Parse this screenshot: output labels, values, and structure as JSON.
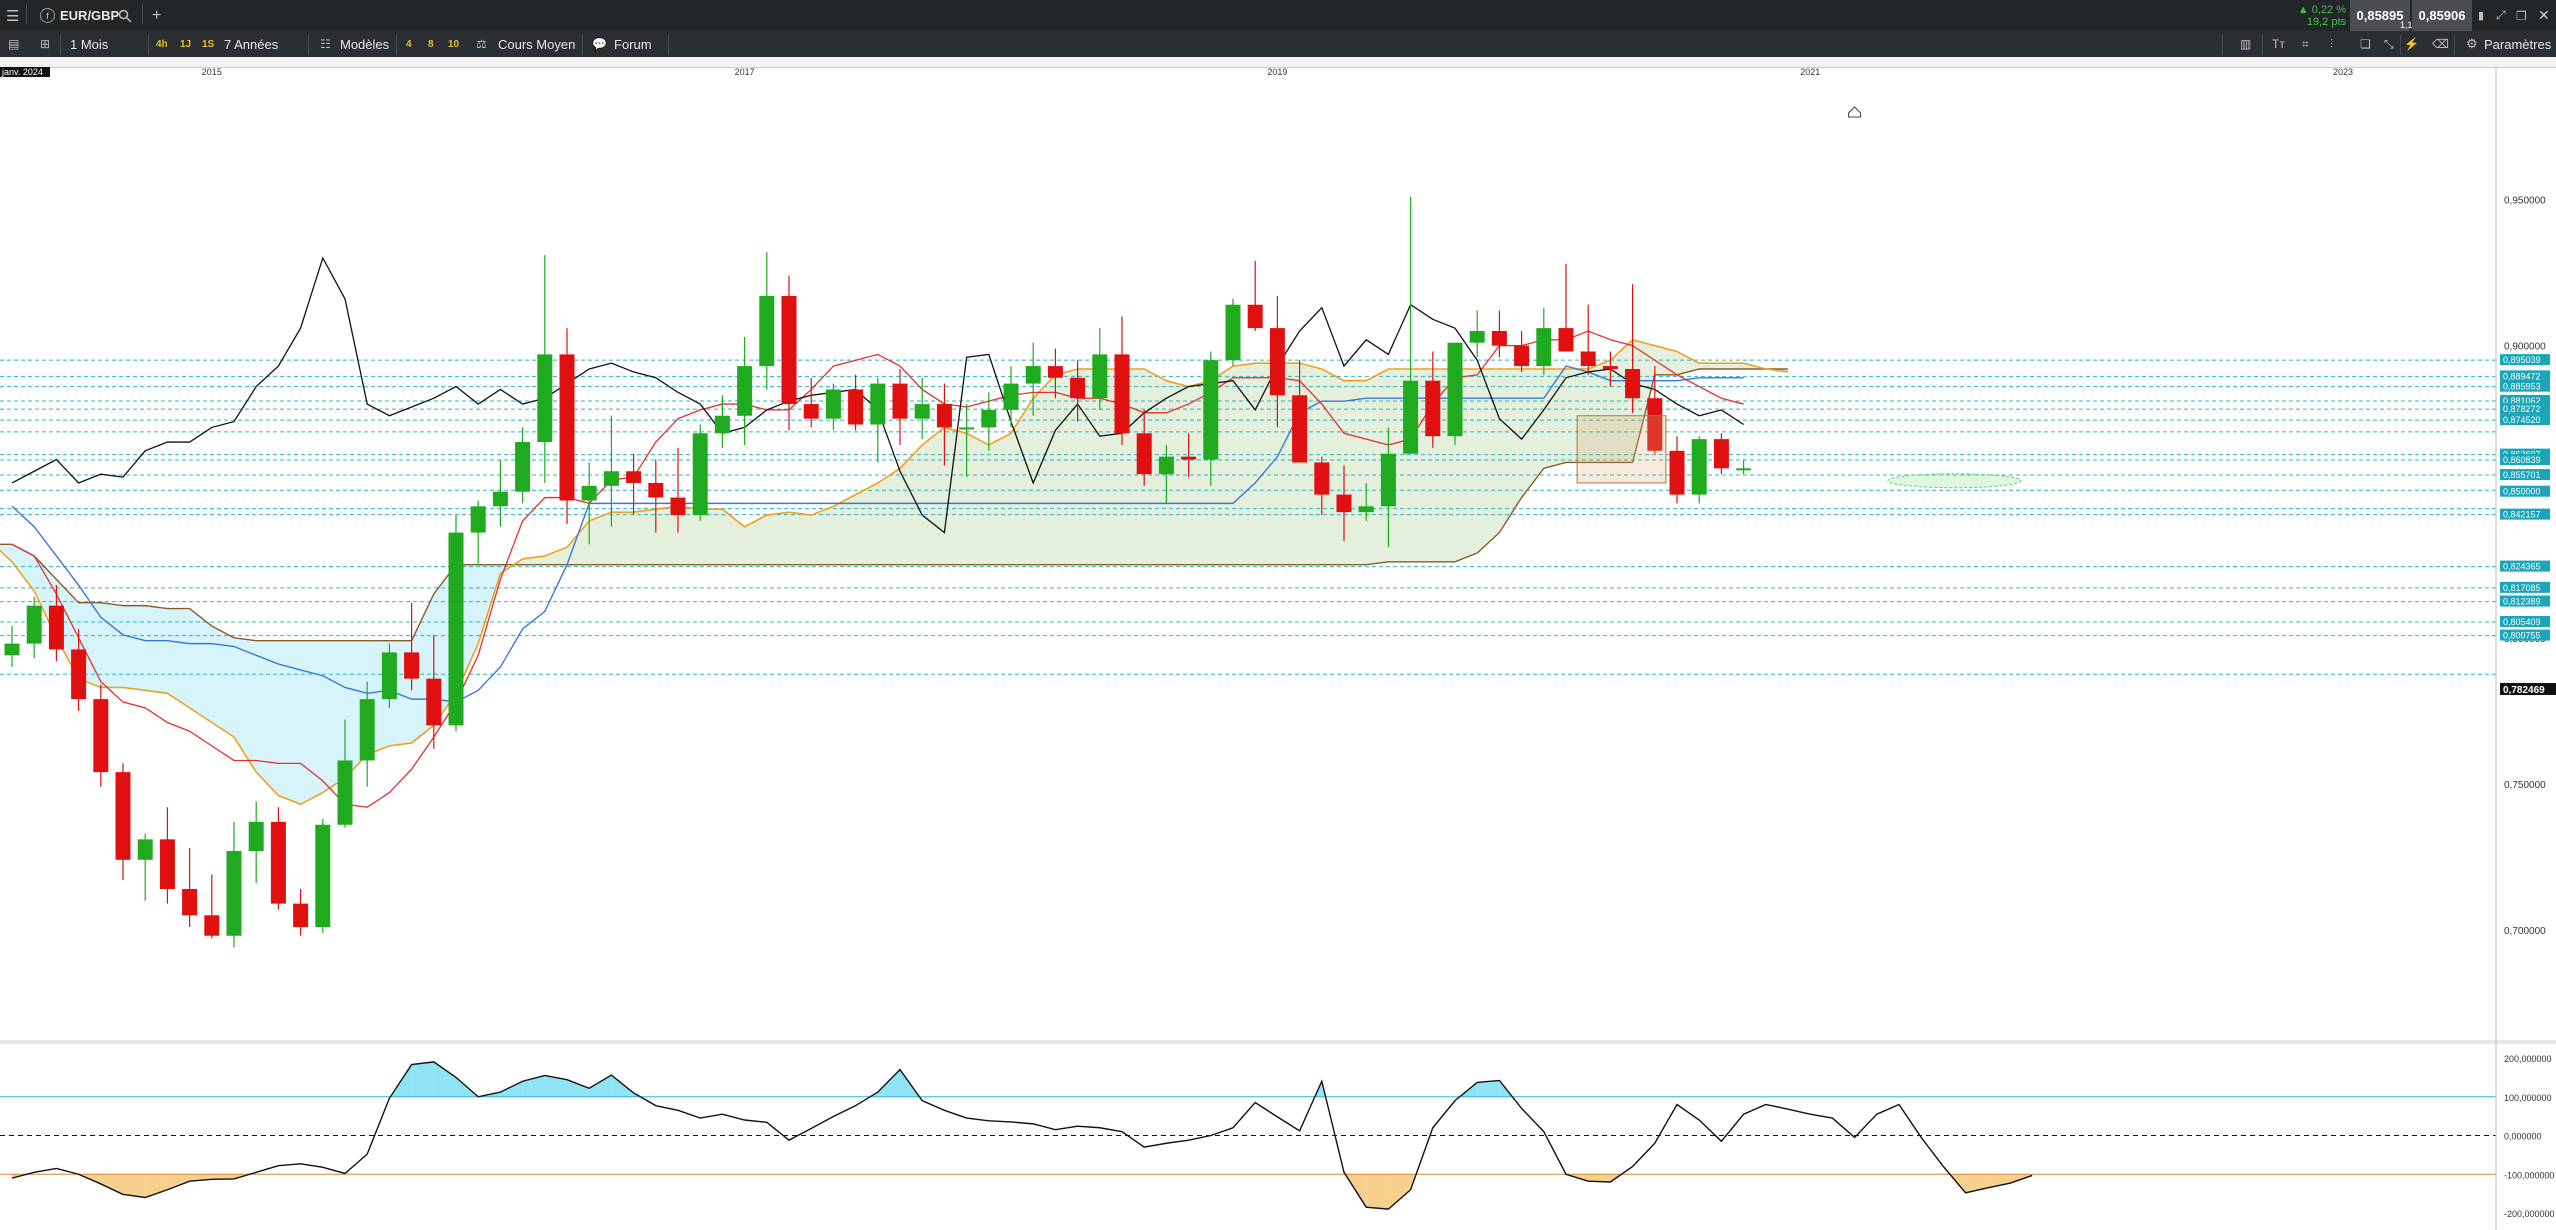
{
  "instrument": {
    "symbol": "EUR/GBP",
    "change_pct": "▲ 0,22 %",
    "change_pts": "19,2 pts",
    "bid": "0,85895",
    "ask": "0,85906",
    "spread": "1,1",
    "settings_label": "Paramètres"
  },
  "toolbar": {
    "period": "1 Mois",
    "tf_4h": "4h",
    "tf_1j": "1J",
    "tf_1s": "1S",
    "range": "7 Années",
    "models_label": "Modèles",
    "m_4": "4",
    "m_8": "8",
    "m_10": "10",
    "average_label": "Cours Moyen",
    "forum_label": "Forum"
  },
  "datebar": {
    "current_label": "janv. 2024",
    "years": [
      "2015",
      "2017",
      "2019",
      "2021",
      "2023"
    ]
  },
  "colors": {
    "bull": "#1faa1f",
    "bear": "#e01010",
    "tenkan": "#e23030",
    "kijun": "#3a78d8",
    "chikou": "#111111",
    "span_a": "#f0a020",
    "span_b": "#8a5a2a",
    "cloud_bull": "#d6f4f9",
    "cloud_bear": "#e4efdc",
    "level_line": "#27b5c8",
    "cci_pos_fill": "#8fe3f4",
    "cci_neg_fill": "#f7cf8e"
  },
  "chart_data": [
    {
      "type": "candlestick",
      "title": "",
      "x_start": "2014-04",
      "interval": "1M",
      "x_axis_ticks": [
        "2015",
        "2017",
        "2019",
        "2021",
        "2023"
      ],
      "y_axis_ticks": [
        "0,950000",
        "0,900000",
        "0,850000",
        "0,800000",
        "0,750000",
        "0,700000"
      ],
      "ylim": [
        0.663,
        0.981
      ],
      "last_price_label": "0,782469",
      "ohlc": [
        [
          0.794,
          0.804,
          0.79,
          0.798
        ],
        [
          0.798,
          0.814,
          0.793,
          0.811
        ],
        [
          0.811,
          0.818,
          0.792,
          0.796
        ],
        [
          0.796,
          0.803,
          0.775,
          0.779
        ],
        [
          0.779,
          0.784,
          0.749,
          0.754
        ],
        [
          0.754,
          0.757,
          0.717,
          0.724
        ],
        [
          0.724,
          0.733,
          0.71,
          0.731
        ],
        [
          0.731,
          0.742,
          0.709,
          0.714
        ],
        [
          0.714,
          0.728,
          0.701,
          0.705
        ],
        [
          0.705,
          0.719,
          0.697,
          0.698
        ],
        [
          0.698,
          0.737,
          0.694,
          0.727
        ],
        [
          0.727,
          0.744,
          0.716,
          0.737
        ],
        [
          0.737,
          0.742,
          0.707,
          0.709
        ],
        [
          0.709,
          0.714,
          0.698,
          0.701
        ],
        [
          0.701,
          0.738,
          0.699,
          0.736
        ],
        [
          0.736,
          0.772,
          0.735,
          0.758
        ],
        [
          0.758,
          0.785,
          0.749,
          0.779
        ],
        [
          0.779,
          0.798,
          0.776,
          0.795
        ],
        [
          0.795,
          0.812,
          0.782,
          0.786
        ],
        [
          0.786,
          0.801,
          0.762,
          0.77
        ],
        [
          0.77,
          0.842,
          0.768,
          0.836
        ],
        [
          0.836,
          0.847,
          0.825,
          0.845
        ],
        [
          0.845,
          0.861,
          0.838,
          0.85
        ],
        [
          0.85,
          0.872,
          0.846,
          0.867
        ],
        [
          0.867,
          0.931,
          0.853,
          0.897
        ],
        [
          0.897,
          0.906,
          0.839,
          0.847
        ],
        [
          0.847,
          0.86,
          0.832,
          0.852
        ],
        [
          0.852,
          0.876,
          0.838,
          0.857
        ],
        [
          0.857,
          0.863,
          0.842,
          0.853
        ],
        [
          0.853,
          0.861,
          0.836,
          0.848
        ],
        [
          0.848,
          0.865,
          0.836,
          0.842
        ],
        [
          0.842,
          0.873,
          0.84,
          0.87
        ],
        [
          0.87,
          0.883,
          0.865,
          0.876
        ],
        [
          0.876,
          0.903,
          0.866,
          0.893
        ],
        [
          0.893,
          0.932,
          0.885,
          0.917
        ],
        [
          0.917,
          0.924,
          0.871,
          0.88
        ],
        [
          0.88,
          0.889,
          0.872,
          0.875
        ],
        [
          0.875,
          0.887,
          0.871,
          0.885
        ],
        [
          0.885,
          0.89,
          0.871,
          0.873
        ],
        [
          0.873,
          0.889,
          0.86,
          0.887
        ],
        [
          0.887,
          0.892,
          0.866,
          0.875
        ],
        [
          0.875,
          0.889,
          0.868,
          0.88
        ],
        [
          0.88,
          0.887,
          0.859,
          0.872
        ],
        [
          0.872,
          0.88,
          0.855,
          0.872
        ],
        [
          0.872,
          0.884,
          0.864,
          0.878
        ],
        [
          0.878,
          0.893,
          0.872,
          0.887
        ],
        [
          0.887,
          0.901,
          0.876,
          0.893
        ],
        [
          0.893,
          0.899,
          0.882,
          0.889
        ],
        [
          0.889,
          0.895,
          0.874,
          0.882
        ],
        [
          0.882,
          0.906,
          0.878,
          0.897
        ],
        [
          0.897,
          0.91,
          0.866,
          0.87
        ],
        [
          0.87,
          0.878,
          0.852,
          0.856
        ],
        [
          0.856,
          0.866,
          0.846,
          0.862
        ],
        [
          0.862,
          0.87,
          0.855,
          0.861
        ],
        [
          0.861,
          0.898,
          0.852,
          0.895
        ],
        [
          0.895,
          0.916,
          0.893,
          0.914
        ],
        [
          0.914,
          0.929,
          0.905,
          0.906
        ],
        [
          0.906,
          0.917,
          0.872,
          0.883
        ],
        [
          0.883,
          0.895,
          0.86,
          0.86
        ],
        [
          0.86,
          0.862,
          0.842,
          0.849
        ],
        [
          0.849,
          0.859,
          0.833,
          0.843
        ],
        [
          0.843,
          0.853,
          0.84,
          0.845
        ],
        [
          0.845,
          0.872,
          0.831,
          0.863
        ],
        [
          0.863,
          0.951,
          0.863,
          0.888
        ],
        [
          0.888,
          0.898,
          0.865,
          0.869
        ],
        [
          0.869,
          0.897,
          0.866,
          0.901
        ],
        [
          0.901,
          0.912,
          0.896,
          0.905
        ],
        [
          0.905,
          0.912,
          0.896,
          0.9
        ],
        [
          0.9,
          0.905,
          0.891,
          0.893
        ],
        [
          0.893,
          0.913,
          0.89,
          0.906
        ],
        [
          0.906,
          0.928,
          0.898,
          0.898
        ],
        [
          0.898,
          0.914,
          0.89,
          0.893
        ],
        [
          0.893,
          0.898,
          0.886,
          0.892
        ],
        [
          0.892,
          0.921,
          0.877,
          0.882
        ],
        [
          0.882,
          0.893,
          0.863,
          0.864
        ],
        [
          0.864,
          0.869,
          0.846,
          0.849
        ],
        [
          0.849,
          0.869,
          0.846,
          0.868
        ],
        [
          0.868,
          0.87,
          0.856,
          0.858
        ],
        [
          0.858,
          0.861,
          0.856,
          0.858
        ]
      ],
      "ichimoku_lines": {
        "tenkan": [
          0.832,
          0.828,
          0.815,
          0.8,
          0.785,
          0.778,
          0.776,
          0.771,
          0.768,
          0.763,
          0.758,
          0.758,
          0.757,
          0.757,
          0.751,
          0.743,
          0.742,
          0.747,
          0.755,
          0.766,
          0.778,
          0.794,
          0.82,
          0.84,
          0.848,
          0.848,
          0.846,
          0.854,
          0.855,
          0.867,
          0.875,
          0.878,
          0.88,
          0.88,
          0.878,
          0.878,
          0.885,
          0.893,
          0.895,
          0.897,
          0.893,
          0.885,
          0.88,
          0.879,
          0.881,
          0.883,
          0.884,
          0.884,
          0.882,
          0.882,
          0.88,
          0.877,
          0.877,
          0.88,
          0.884,
          0.889,
          0.889,
          0.889,
          0.888,
          0.88,
          0.87,
          0.868,
          0.866,
          0.868,
          0.88,
          0.889,
          0.89,
          0.9,
          0.9,
          0.902,
          0.902,
          0.905,
          0.902,
          0.9,
          0.895,
          0.89,
          0.886,
          0.882,
          0.88
        ],
        "kijun": [
          0.845,
          0.838,
          0.828,
          0.818,
          0.807,
          0.801,
          0.799,
          0.799,
          0.798,
          0.798,
          0.797,
          0.794,
          0.791,
          0.789,
          0.787,
          0.783,
          0.781,
          0.782,
          0.779,
          0.779,
          0.778,
          0.782,
          0.79,
          0.803,
          0.809,
          0.825,
          0.846,
          0.846,
          0.846,
          0.846,
          0.846,
          0.846,
          0.846,
          0.846,
          0.846,
          0.846,
          0.846,
          0.846,
          0.846,
          0.846,
          0.846,
          0.846,
          0.846,
          0.846,
          0.846,
          0.846,
          0.846,
          0.846,
          0.846,
          0.846,
          0.846,
          0.846,
          0.846,
          0.846,
          0.846,
          0.846,
          0.853,
          0.862,
          0.877,
          0.881,
          0.881,
          0.882,
          0.882,
          0.882,
          0.882,
          0.882,
          0.882,
          0.882,
          0.882,
          0.882,
          0.893,
          0.891,
          0.888,
          0.888,
          0.888,
          0.888,
          0.889,
          0.889,
          0.889
        ],
        "chikou_first_index": 0,
        "chikou": [
          0.853,
          0.857,
          0.861,
          0.853,
          0.856,
          0.855,
          0.864,
          0.867,
          0.867,
          0.872,
          0.874,
          0.886,
          0.893,
          0.906,
          0.93,
          0.916,
          0.88,
          0.876,
          0.879,
          0.882,
          0.886,
          0.88,
          0.885,
          0.88,
          0.882,
          0.887,
          0.892,
          0.894,
          0.891,
          0.889,
          0.884,
          0.88,
          0.87,
          0.872,
          0.878,
          0.881,
          0.883,
          0.884,
          0.885,
          0.878,
          0.857,
          0.842,
          0.836,
          0.896,
          0.897,
          0.874,
          0.853,
          0.871,
          0.88,
          0.869,
          0.87,
          0.877,
          0.882,
          0.886,
          0.887,
          0.888,
          0.878,
          0.893,
          0.905,
          0.913,
          0.893,
          0.902,
          0.897,
          0.914,
          0.909,
          0.906,
          0.895,
          0.875,
          0.868,
          0.878,
          0.889,
          0.891,
          0.892,
          0.887,
          0.885,
          0.88,
          0.876,
          0.878,
          0.873
        ],
        "span_a_offset": -26,
        "span_a": [
          0.835,
          0.834,
          0.831,
          0.826,
          0.815,
          0.81,
          0.81,
          0.81,
          0.807,
          0.801,
          0.799,
          0.799,
          0.804,
          0.807,
          0.815,
          0.833,
          0.836,
          0.838,
          0.839,
          0.839,
          0.84,
          0.842,
          0.844,
          0.845,
          0.84,
          0.833,
          0.826,
          0.816,
          0.8,
          0.786,
          0.783,
          0.783,
          0.782,
          0.781,
          0.776,
          0.771,
          0.766,
          0.754,
          0.746,
          0.743,
          0.747,
          0.752,
          0.76,
          0.763,
          0.764,
          0.77,
          0.781,
          0.798,
          0.822,
          0.827,
          0.828,
          0.831,
          0.84,
          0.843,
          0.843,
          0.844,
          0.845,
          0.844,
          0.844,
          0.838,
          0.842,
          0.843,
          0.842,
          0.845,
          0.849,
          0.853,
          0.858,
          0.866,
          0.872,
          0.87,
          0.866,
          0.87,
          0.882,
          0.89,
          0.892,
          0.892,
          0.892,
          0.892,
          0.888,
          0.886,
          0.888,
          0.893,
          0.894,
          0.894,
          0.894,
          0.892,
          0.888,
          0.888,
          0.892,
          0.892,
          0.892,
          0.892,
          0.892,
          0.892,
          0.892,
          0.892,
          0.892,
          0.892,
          0.895,
          0.902,
          0.9,
          0.898,
          0.894,
          0.894,
          0.894,
          0.892,
          0.891
        ],
        "span_b": [
          0.873,
          0.873,
          0.873,
          0.873,
          0.873,
          0.873,
          0.873,
          0.873,
          0.873,
          0.873,
          0.87,
          0.858,
          0.858,
          0.858,
          0.858,
          0.858,
          0.856,
          0.846,
          0.846,
          0.846,
          0.846,
          0.846,
          0.845,
          0.844,
          0.838,
          0.832,
          0.832,
          0.828,
          0.82,
          0.812,
          0.812,
          0.811,
          0.811,
          0.81,
          0.81,
          0.804,
          0.8,
          0.799,
          0.799,
          0.799,
          0.799,
          0.799,
          0.799,
          0.799,
          0.799,
          0.815,
          0.825,
          0.825,
          0.825,
          0.825,
          0.825,
          0.825,
          0.825,
          0.825,
          0.825,
          0.825,
          0.825,
          0.825,
          0.825,
          0.825,
          0.825,
          0.825,
          0.825,
          0.825,
          0.825,
          0.825,
          0.825,
          0.825,
          0.825,
          0.825,
          0.825,
          0.825,
          0.825,
          0.825,
          0.825,
          0.825,
          0.825,
          0.825,
          0.825,
          0.825,
          0.825,
          0.825,
          0.825,
          0.825,
          0.825,
          0.825,
          0.825,
          0.825,
          0.826,
          0.826,
          0.826,
          0.826,
          0.829,
          0.836,
          0.848,
          0.858,
          0.86,
          0.86,
          0.86,
          0.86,
          0.89,
          0.89,
          0.892,
          0.892,
          0.892,
          0.892,
          0.892
        ]
      },
      "level_labels": [
        "0,895039",
        "0,889472",
        "0,885953",
        "0,881062",
        "0,878272",
        "0,874520",
        "0,862697",
        "0,860839",
        "0,855701",
        "0,850000",
        "0,842157",
        "0,824365",
        "0,817085",
        "0,812389",
        "0,805409",
        "0,800755"
      ],
      "levels": [
        0.895039,
        0.889472,
        0.885953,
        0.881062,
        0.878272,
        0.87452,
        0.8705,
        0.862697,
        0.860839,
        0.855701,
        0.8505,
        0.8442,
        0.842157,
        0.824365,
        0.817085,
        0.812389,
        0.805409,
        0.800755,
        0.7875
      ],
      "boxes": [
        {
          "x0": 70.5,
          "x1": 74.5,
          "y0": 0.853,
          "y1": 0.876,
          "type": "rect"
        },
        {
          "x0": 84.5,
          "x1": 90.5,
          "y0": 0.852,
          "y1": 0.8555,
          "type": "ellipse"
        }
      ]
    },
    {
      "type": "line",
      "title": "",
      "indicator": "CCI",
      "y_axis_ticks": [
        "200,000000",
        "100,000000",
        "0,000000",
        "-100,000000",
        "-200,000000"
      ],
      "ylim": [
        -200,
        200
      ],
      "reference_lines": [
        100,
        0,
        -100
      ],
      "values": [
        -110,
        -95,
        -85,
        -100,
        -125,
        -152,
        -160,
        -140,
        -118,
        -113,
        -112,
        -95,
        -78,
        -73,
        -82,
        -98,
        -48,
        96,
        183,
        190,
        150,
        100,
        112,
        140,
        155,
        144,
        122,
        156,
        110,
        77,
        65,
        45,
        55,
        40,
        34,
        -12,
        18,
        49,
        77,
        112,
        170,
        90,
        65,
        45,
        38,
        35,
        30,
        15,
        24,
        20,
        10,
        -30,
        -20,
        -12,
        0,
        20,
        85,
        48,
        12,
        140,
        -95,
        -185,
        -190,
        -140,
        20,
        90,
        137,
        142,
        70,
        10,
        -100,
        -118,
        -120,
        -80,
        -20,
        80,
        40,
        -15,
        55,
        80,
        68,
        55,
        45,
        -5,
        55,
        80,
        -5,
        -80,
        -148,
        -135,
        -123,
        -103
      ]
    }
  ]
}
